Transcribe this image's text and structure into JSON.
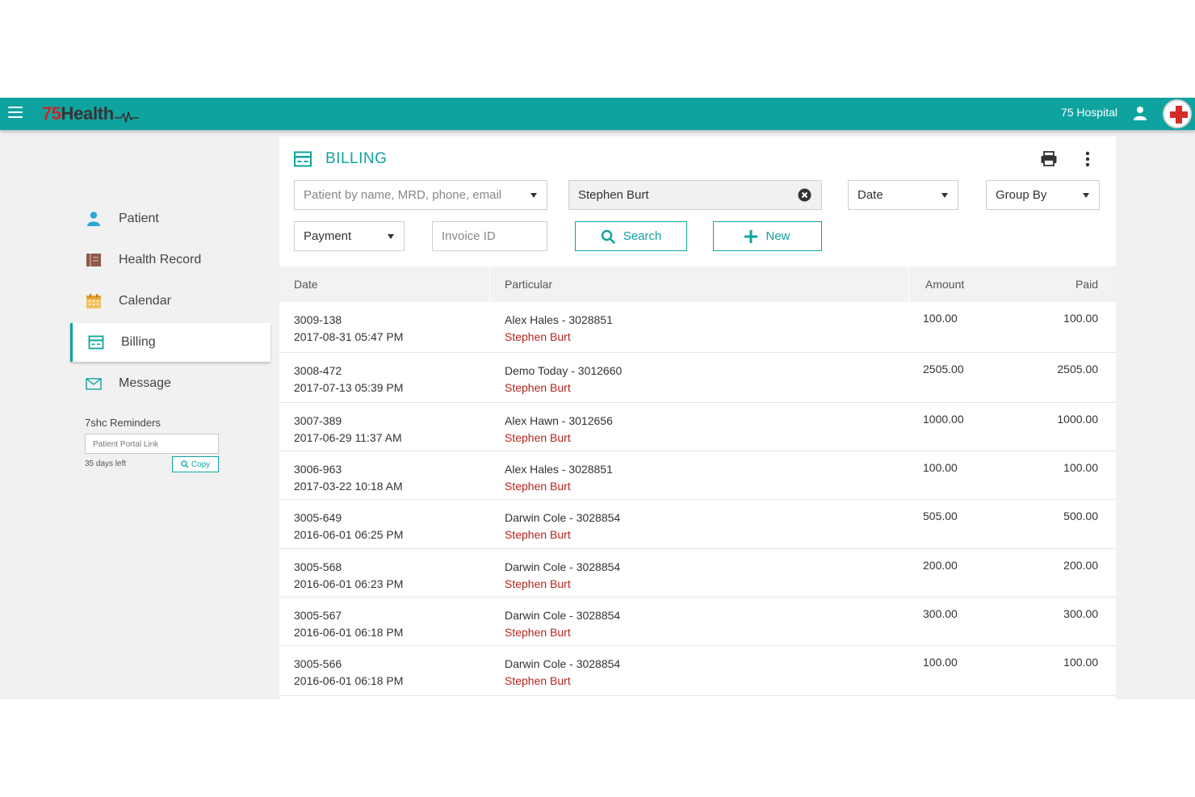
{
  "topbar": {
    "logo_num": "75",
    "logo_word": "Health",
    "hospital": "75 Hospital"
  },
  "sidebar": {
    "items": [
      {
        "label": "Patient",
        "icon": "person-icon"
      },
      {
        "label": "Health Record",
        "icon": "record-icon"
      },
      {
        "label": "Calendar",
        "icon": "calendar-icon"
      },
      {
        "label": "Billing",
        "icon": "billing-icon",
        "active": true
      },
      {
        "label": "Message",
        "icon": "envelope-icon"
      }
    ],
    "reminders_title": "7shc Reminders",
    "portal_link_placeholder": "Patient Portal Link",
    "days_left": "35 days left",
    "copy_label": "Copy"
  },
  "billing": {
    "title": "BILLING",
    "patient_search_placeholder": "Patient by name, MRD, phone, email",
    "selected_patient": "Stephen Burt",
    "date_label": "Date",
    "group_by_label": "Group By",
    "payment_label": "Payment",
    "invoice_placeholder": "Invoice ID",
    "search_label": "Search",
    "new_label": "New",
    "columns": {
      "date": "Date",
      "particular": "Particular",
      "amount": "Amount",
      "paid": "Paid"
    },
    "rows": [
      {
        "id": "3009-138",
        "datetime": "2017-08-31 05:47 PM",
        "particular": "Alex Hales - 3028851",
        "patient": "Stephen Burt",
        "amount": "100.00",
        "paid": "100.00"
      },
      {
        "id": "3008-472",
        "datetime": "2017-07-13 05:39 PM",
        "particular": "Demo Today - 3012660",
        "patient": "Stephen Burt",
        "amount": "2505.00",
        "paid": "2505.00"
      },
      {
        "id": "3007-389",
        "datetime": "2017-06-29 11:37 AM",
        "particular": "Alex Hawn - 3012656",
        "patient": "Stephen Burt",
        "amount": "1000.00",
        "paid": "1000.00"
      },
      {
        "id": "3006-963",
        "datetime": "2017-03-22 10:18 AM",
        "particular": "Alex Hales - 3028851",
        "patient": "Stephen Burt",
        "amount": "100.00",
        "paid": "100.00"
      },
      {
        "id": "3005-649",
        "datetime": "2016-06-01 06:25 PM",
        "particular": "Darwin Cole - 3028854",
        "patient": "Stephen Burt",
        "amount": "505.00",
        "paid": "500.00"
      },
      {
        "id": "3005-568",
        "datetime": "2016-06-01 06:23 PM",
        "particular": "Darwin Cole - 3028854",
        "patient": "Stephen Burt",
        "amount": "200.00",
        "paid": "200.00"
      },
      {
        "id": "3005-567",
        "datetime": "2016-06-01 06:18 PM",
        "particular": "Darwin Cole - 3028854",
        "patient": "Stephen Burt",
        "amount": "300.00",
        "paid": "300.00"
      },
      {
        "id": "3005-566",
        "datetime": "2016-06-01 06:18 PM",
        "particular": "Darwin Cole - 3028854",
        "patient": "Stephen Burt",
        "amount": "100.00",
        "paid": "100.00"
      }
    ]
  },
  "colors": {
    "accent": "#0fa3a0",
    "danger": "#b3261e",
    "logo_red": "#c62828"
  }
}
